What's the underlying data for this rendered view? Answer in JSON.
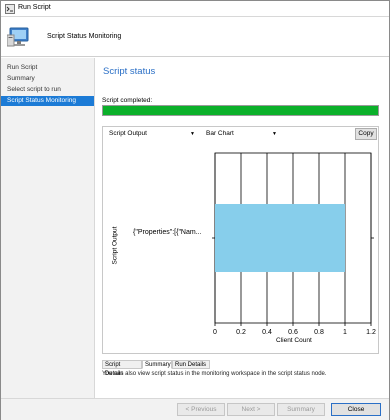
{
  "window": {
    "title": "Run Script"
  },
  "header": {
    "title": "Script Status Monitoring"
  },
  "sidebar": {
    "items": [
      {
        "label": "Run Script",
        "active": false
      },
      {
        "label": "Summary",
        "active": false
      },
      {
        "label": "Select script to run",
        "active": false
      },
      {
        "label": "Script Status Monitoring",
        "active": true
      }
    ]
  },
  "main": {
    "section_title": "Script status",
    "completed_label": "Script completed:",
    "progress_fraction": 1.0,
    "progress_color": "#0bb02a",
    "output_select": "Script Output",
    "chart_select": "Bar Chart",
    "copy_label": "Copy"
  },
  "chart_data": {
    "type": "bar",
    "orientation": "horizontal",
    "categories": [
      "{\"Properties\":[{\"Nam..."
    ],
    "values": [
      1
    ],
    "xlabel": "Client Count",
    "ylabel": "Script Output",
    "xlim": [
      0,
      1.2
    ],
    "xticks": [
      "0",
      "0.2",
      "0.4",
      "0.6",
      "0.8",
      "1",
      "1.2"
    ],
    "bar_color": "#87ceeb",
    "grid": true
  },
  "tabs": {
    "details": "Script Details",
    "summary": "Summary",
    "run": "Run Details"
  },
  "info_text": "You can also view script status in the monitoring workspace in the script status node.",
  "footer": {
    "previous": "< Previous",
    "next": "Next >",
    "summary": "Summary",
    "close": "Close"
  }
}
